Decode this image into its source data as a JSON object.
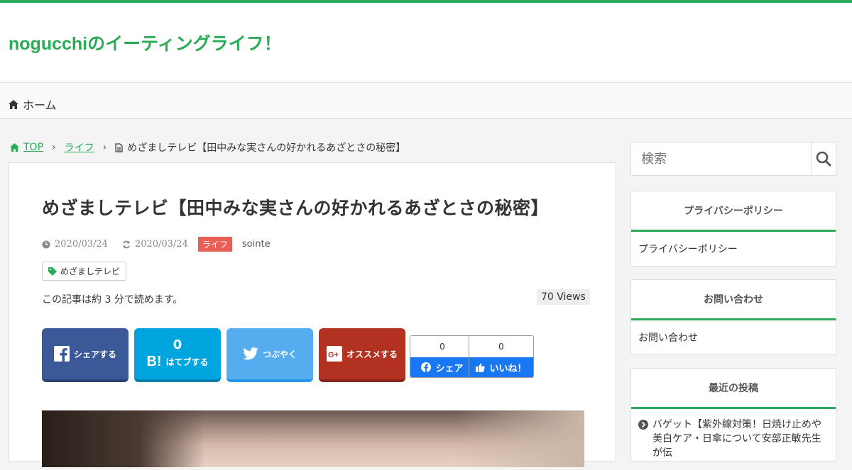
{
  "header": {
    "site_title": "nogucchiのイーティングライフ！"
  },
  "nav": {
    "home_label": "ホーム"
  },
  "breadcrumb": {
    "top": "TOP",
    "category": "ライフ",
    "current": "めざましテレビ【田中みな実さんの好かれるあざとさの秘密】"
  },
  "article": {
    "title": "めざましテレビ【田中みな実さんの好かれるあざとさの秘密】",
    "published": "2020/03/24",
    "updated": "2020/03/24",
    "category": "ライフ",
    "author": "sointe",
    "tag": "めざましテレビ",
    "read_time": "この記事は約 3 分で読めます。",
    "views": "70 Views"
  },
  "share": {
    "facebook": "シェアする",
    "hatena_count": "0",
    "hatena": "はてブする",
    "twitter": "つぶやく",
    "google": "オススメする",
    "fb_share_count": "0",
    "fb_share": "シェア",
    "fb_like_count": "0",
    "fb_like": "いいね！"
  },
  "sidebar": {
    "search_placeholder": "検索",
    "widgets": [
      {
        "title": "プライバシーポリシー",
        "link": "プライバシーポリシー"
      },
      {
        "title": "お問い合わせ",
        "link": "お問い合わせ"
      },
      {
        "title": "最近の投稿",
        "link": "バゲット【紫外線対策！日焼け止めや美白ケア・日傘について安部正敏先生が伝"
      }
    ]
  },
  "colors": {
    "accent": "#2bab55",
    "category": "#e85f55",
    "facebook": "#3b5998",
    "hatena": "#00a4de",
    "twitter": "#55acee",
    "google": "#b23121"
  }
}
